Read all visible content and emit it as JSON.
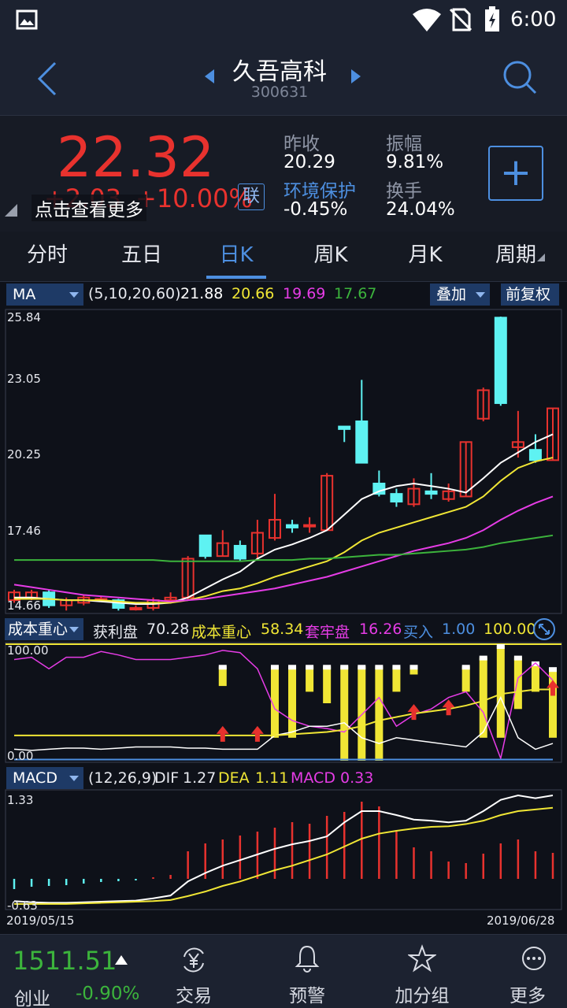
{
  "status_bar": {
    "time": "6:00",
    "icons": [
      "image-icon",
      "wifi-icon",
      "no-sim-icon",
      "battery-charging-icon"
    ]
  },
  "header": {
    "stock_name": "久吾高科",
    "stock_code": "300631",
    "icons": [
      "back-arrow-icon",
      "prev-stock-icon",
      "next-stock-icon",
      "search-icon"
    ]
  },
  "quote": {
    "price": "22.32",
    "change": "+2.03",
    "change_pct": "+10.00%",
    "link_badge": "联",
    "tap_hint": "点击查看更多",
    "prev_close_label": "昨收",
    "prev_close": "20.29",
    "sector_label": "环境保护",
    "sector_change": "-0.45%",
    "amplitude_label": "振幅",
    "amplitude": "9.81%",
    "turnover_label": "换手",
    "turnover": "24.04%",
    "add_button": "+"
  },
  "tabs": [
    {
      "label": "分时",
      "active": false
    },
    {
      "label": "五日",
      "active": false
    },
    {
      "label": "日K",
      "active": true
    },
    {
      "label": "周K",
      "active": false
    },
    {
      "label": "月K",
      "active": false
    },
    {
      "label": "周期",
      "active": false
    }
  ],
  "ma_panel": {
    "selector": "MA",
    "params": "(5,10,20,60)",
    "ma5": "21.88",
    "ma10": "20.66",
    "ma20": "19.69",
    "ma60": "17.67",
    "overlay_button": "叠加",
    "adjust_button": "前复权",
    "y_ticks": [
      "25.84",
      "23.05",
      "20.25",
      "17.46",
      "14.66"
    ],
    "colors": {
      "ma5": "#ffffff",
      "ma10": "#f0e635",
      "ma20": "#e63ce6",
      "ma60": "#3cb43c",
      "up": "#e8322e",
      "down": "#5ef2f2"
    }
  },
  "cost_panel": {
    "selector": "成本重心",
    "profit_label": "获利盘",
    "profit": "70.28",
    "cost_label": "成本重心",
    "cost": "58.34",
    "trapped_label": "套牢盘",
    "trapped": "16.26",
    "buy_label": "买入",
    "buy": "1.00",
    "top_value": "100.00",
    "y_top": "100.00",
    "y_bottom": "0.00"
  },
  "macd_panel": {
    "selector": "MACD",
    "params": "(12,26,9)",
    "dif_label": "DIF",
    "dif": "1.27",
    "dea_label": "DEA",
    "dea": "1.11",
    "macd_label": "MACD",
    "macd": "0.33",
    "y_top": "1.33",
    "y_bottom": "-0.63",
    "date_start": "2019/05/15",
    "date_end": "2019/06/28"
  },
  "chart_data": {
    "type": "candlestick",
    "x_range": [
      "2019/05/15",
      "2019/06/28"
    ],
    "ylim": [
      14.66,
      25.84
    ],
    "candles": [
      {
        "o": 14.9,
        "c": 15.2,
        "h": 15.3,
        "l": 14.8
      },
      {
        "o": 15.0,
        "c": 15.2,
        "h": 15.3,
        "l": 14.9
      },
      {
        "o": 15.2,
        "c": 14.7,
        "h": 15.3,
        "l": 14.6
      },
      {
        "o": 14.7,
        "c": 14.9,
        "h": 15.0,
        "l": 14.5
      },
      {
        "o": 14.8,
        "c": 15.0,
        "h": 15.1,
        "l": 14.7
      },
      {
        "o": 14.95,
        "c": 14.95,
        "h": 15.05,
        "l": 14.85
      },
      {
        "o": 14.9,
        "c": 14.6,
        "h": 14.95,
        "l": 14.5
      },
      {
        "o": 14.6,
        "c": 14.6,
        "h": 14.7,
        "l": 14.5
      },
      {
        "o": 14.6,
        "c": 14.9,
        "h": 15.0,
        "l": 14.5
      },
      {
        "o": 14.9,
        "c": 15.0,
        "h": 15.2,
        "l": 14.8
      },
      {
        "o": 15.0,
        "c": 16.5,
        "h": 16.6,
        "l": 14.9
      },
      {
        "o": 17.4,
        "c": 16.6,
        "h": 17.4,
        "l": 16.5
      },
      {
        "o": 16.6,
        "c": 17.1,
        "h": 17.6,
        "l": 16.6
      },
      {
        "o": 17.0,
        "c": 16.5,
        "h": 17.2,
        "l": 16.4
      },
      {
        "o": 16.7,
        "c": 17.5,
        "h": 18.0,
        "l": 16.5
      },
      {
        "o": 17.3,
        "c": 18.0,
        "h": 19.0,
        "l": 17.2
      },
      {
        "o": 17.8,
        "c": 17.7,
        "h": 18.0,
        "l": 17.5
      },
      {
        "o": 17.8,
        "c": 17.8,
        "h": 18.1,
        "l": 17.5
      },
      {
        "o": 17.6,
        "c": 19.7,
        "h": 19.8,
        "l": 17.6
      },
      {
        "o": 21.6,
        "c": 21.5,
        "h": 21.6,
        "l": 21.0
      },
      {
        "o": 21.8,
        "c": 20.2,
        "h": 23.4,
        "l": 20.2
      },
      {
        "o": 19.4,
        "c": 19.0,
        "h": 19.9,
        "l": 18.9
      },
      {
        "o": 19.0,
        "c": 18.7,
        "h": 19.2,
        "l": 18.5
      },
      {
        "o": 18.6,
        "c": 19.2,
        "h": 19.6,
        "l": 18.5
      },
      {
        "o": 19.1,
        "c": 19.0,
        "h": 19.8,
        "l": 18.8
      },
      {
        "o": 18.8,
        "c": 19.1,
        "h": 19.4,
        "l": 18.7
      },
      {
        "o": 18.9,
        "c": 21.0,
        "h": 21.0,
        "l": 18.9
      },
      {
        "o": 21.9,
        "c": 23.0,
        "h": 23.1,
        "l": 21.8
      },
      {
        "o": 25.8,
        "c": 22.5,
        "h": 25.84,
        "l": 22.4
      },
      {
        "o": 20.8,
        "c": 21.0,
        "h": 22.2,
        "l": 20.4
      },
      {
        "o": 20.7,
        "c": 20.3,
        "h": 21.3,
        "l": 20.2
      },
      {
        "o": 20.3,
        "c": 22.3,
        "h": 22.3,
        "l": 20.3
      }
    ],
    "series": [
      {
        "name": "MA5",
        "values": [
          15.0,
          15.0,
          14.95,
          14.9,
          14.9,
          14.85,
          14.8,
          14.75,
          14.75,
          14.8,
          15.0,
          15.35,
          15.7,
          16.0,
          16.5,
          16.85,
          17.05,
          17.3,
          17.6,
          18.2,
          18.8,
          19.1,
          19.3,
          19.4,
          19.3,
          19.2,
          19.05,
          19.6,
          20.2,
          20.6,
          21.0,
          21.3
        ]
      },
      {
        "name": "MA10",
        "values": [
          14.95,
          14.95,
          14.95,
          14.9,
          14.9,
          14.9,
          14.85,
          14.8,
          14.8,
          14.8,
          14.9,
          15.05,
          15.25,
          15.35,
          15.55,
          15.8,
          16.0,
          16.2,
          16.4,
          16.75,
          17.2,
          17.5,
          17.7,
          17.9,
          18.1,
          18.3,
          18.5,
          18.9,
          19.5,
          20.0,
          20.25,
          20.4
        ]
      },
      {
        "name": "MA20",
        "values": [
          15.5,
          15.4,
          15.3,
          15.2,
          15.1,
          15.05,
          15.0,
          14.95,
          14.9,
          14.85,
          14.9,
          14.95,
          15.05,
          15.15,
          15.25,
          15.35,
          15.5,
          15.65,
          15.8,
          16.0,
          16.2,
          16.4,
          16.6,
          16.8,
          16.95,
          17.1,
          17.3,
          17.6,
          18.0,
          18.35,
          18.65,
          18.9
        ]
      },
      {
        "name": "MA60",
        "values": [
          16.45,
          16.45,
          16.45,
          16.45,
          16.45,
          16.45,
          16.45,
          16.45,
          16.45,
          16.4,
          16.4,
          16.4,
          16.4,
          16.4,
          16.45,
          16.45,
          16.45,
          16.5,
          16.5,
          16.55,
          16.6,
          16.65,
          16.65,
          16.7,
          16.75,
          16.8,
          16.85,
          16.95,
          17.1,
          17.2,
          17.3,
          17.4
        ]
      }
    ],
    "cost": {
      "ylim": [
        0,
        100
      ],
      "profit": [
        88,
        90,
        80,
        90,
        90,
        95,
        92,
        88,
        88,
        88,
        90,
        92,
        96,
        94,
        80,
        45,
        35,
        30,
        28,
        25,
        40,
        55,
        30,
        40,
        45,
        55,
        60,
        42,
        2,
        72,
        85,
        70
      ],
      "cost_line": [
        22,
        22,
        22,
        22,
        22,
        22,
        22,
        22,
        22,
        22,
        22,
        22,
        22,
        22,
        22,
        22,
        23,
        24,
        25,
        27,
        30,
        35,
        38,
        41,
        43,
        45,
        48,
        52,
        58,
        60,
        62,
        62
      ],
      "trapped": [
        10,
        9,
        10,
        11,
        11,
        10,
        11,
        12,
        12,
        12,
        11,
        11,
        10,
        10,
        10,
        22,
        25,
        30,
        30,
        33,
        20,
        15,
        20,
        18,
        16,
        14,
        12,
        25,
        55,
        20,
        10,
        15
      ],
      "buy": [
        1,
        1,
        1,
        1,
        1,
        1,
        1,
        1,
        1,
        1,
        1,
        1,
        1,
        1,
        1,
        1,
        1,
        1,
        1,
        1,
        1,
        1,
        1,
        1,
        1,
        1,
        1,
        1,
        1,
        1,
        1,
        1
      ],
      "bars": [
        {
          "i": 12,
          "top": 82,
          "bottom": 65,
          "body": "yellow"
        },
        {
          "i": 15,
          "top": 82,
          "bottom": 20,
          "body": "yellow"
        },
        {
          "i": 16,
          "top": 82,
          "bottom": 20,
          "body": "yellow"
        },
        {
          "i": 17,
          "top": 82,
          "bottom": 60,
          "body": "yellow"
        },
        {
          "i": 18,
          "top": 82,
          "bottom": 50,
          "body": "yellow"
        },
        {
          "i": 19,
          "top": 82,
          "bottom": 0,
          "body": "yellow"
        },
        {
          "i": 20,
          "top": 82,
          "bottom": 0,
          "body": "yellow"
        },
        {
          "i": 21,
          "top": 82,
          "bottom": 0,
          "body": "yellow"
        },
        {
          "i": 22,
          "top": 82,
          "bottom": 60,
          "body": "yellow"
        },
        {
          "i": 23,
          "top": 82,
          "bottom": 75,
          "body": "yellow"
        },
        {
          "i": 26,
          "top": 82,
          "bottom": 60,
          "body": "yellow"
        },
        {
          "i": 27,
          "top": 90,
          "bottom": 20,
          "body": "yellow"
        },
        {
          "i": 28,
          "top": 100,
          "bottom": 20,
          "body": "yellow"
        },
        {
          "i": 29,
          "top": 90,
          "bottom": 45,
          "body": "yellow"
        },
        {
          "i": 30,
          "top": 85,
          "bottom": 60,
          "body": "yellow"
        },
        {
          "i": 31,
          "top": 80,
          "bottom": 20,
          "body": "yellow"
        }
      ],
      "buy_marks": [
        12,
        14,
        23,
        25,
        31
      ]
    },
    "macd": {
      "ylim": [
        -0.63,
        1.33
      ],
      "dif": [
        -0.55,
        -0.57,
        -0.58,
        -0.58,
        -0.57,
        -0.56,
        -0.55,
        -0.54,
        -0.5,
        -0.45,
        -0.2,
        -0.05,
        0.08,
        0.18,
        0.28,
        0.38,
        0.46,
        0.52,
        0.6,
        0.85,
        1.05,
        1.05,
        0.98,
        0.9,
        0.88,
        0.85,
        0.88,
        1.05,
        1.25,
        1.33,
        1.28,
        1.33
      ],
      "dea": [
        -0.6,
        -0.6,
        -0.6,
        -0.6,
        -0.59,
        -0.58,
        -0.57,
        -0.56,
        -0.55,
        -0.53,
        -0.46,
        -0.38,
        -0.28,
        -0.2,
        -0.1,
        0.0,
        0.08,
        0.18,
        0.28,
        0.42,
        0.56,
        0.65,
        0.7,
        0.74,
        0.77,
        0.78,
        0.82,
        0.88,
        0.98,
        1.05,
        1.08,
        1.11
      ],
      "hist": [
        -0.13,
        -0.1,
        -0.09,
        -0.08,
        -0.06,
        -0.04,
        -0.03,
        -0.02,
        0.02,
        0.05,
        0.35,
        0.45,
        0.5,
        0.55,
        0.6,
        0.65,
        0.72,
        0.7,
        0.8,
        0.85,
        0.98,
        0.92,
        0.6,
        0.4,
        0.35,
        0.22,
        0.2,
        0.32,
        0.45,
        0.5,
        0.35,
        0.33
      ]
    }
  },
  "bottom_bar": {
    "index_value": "1511.51",
    "index_name": "创业",
    "index_change": "-0.90%",
    "nav": [
      {
        "label": "交易",
        "icon": "yen-exchange-icon"
      },
      {
        "label": "预警",
        "icon": "bell-icon"
      },
      {
        "label": "加分组",
        "icon": "star-icon"
      },
      {
        "label": "更多",
        "icon": "more-dots-icon"
      }
    ]
  }
}
